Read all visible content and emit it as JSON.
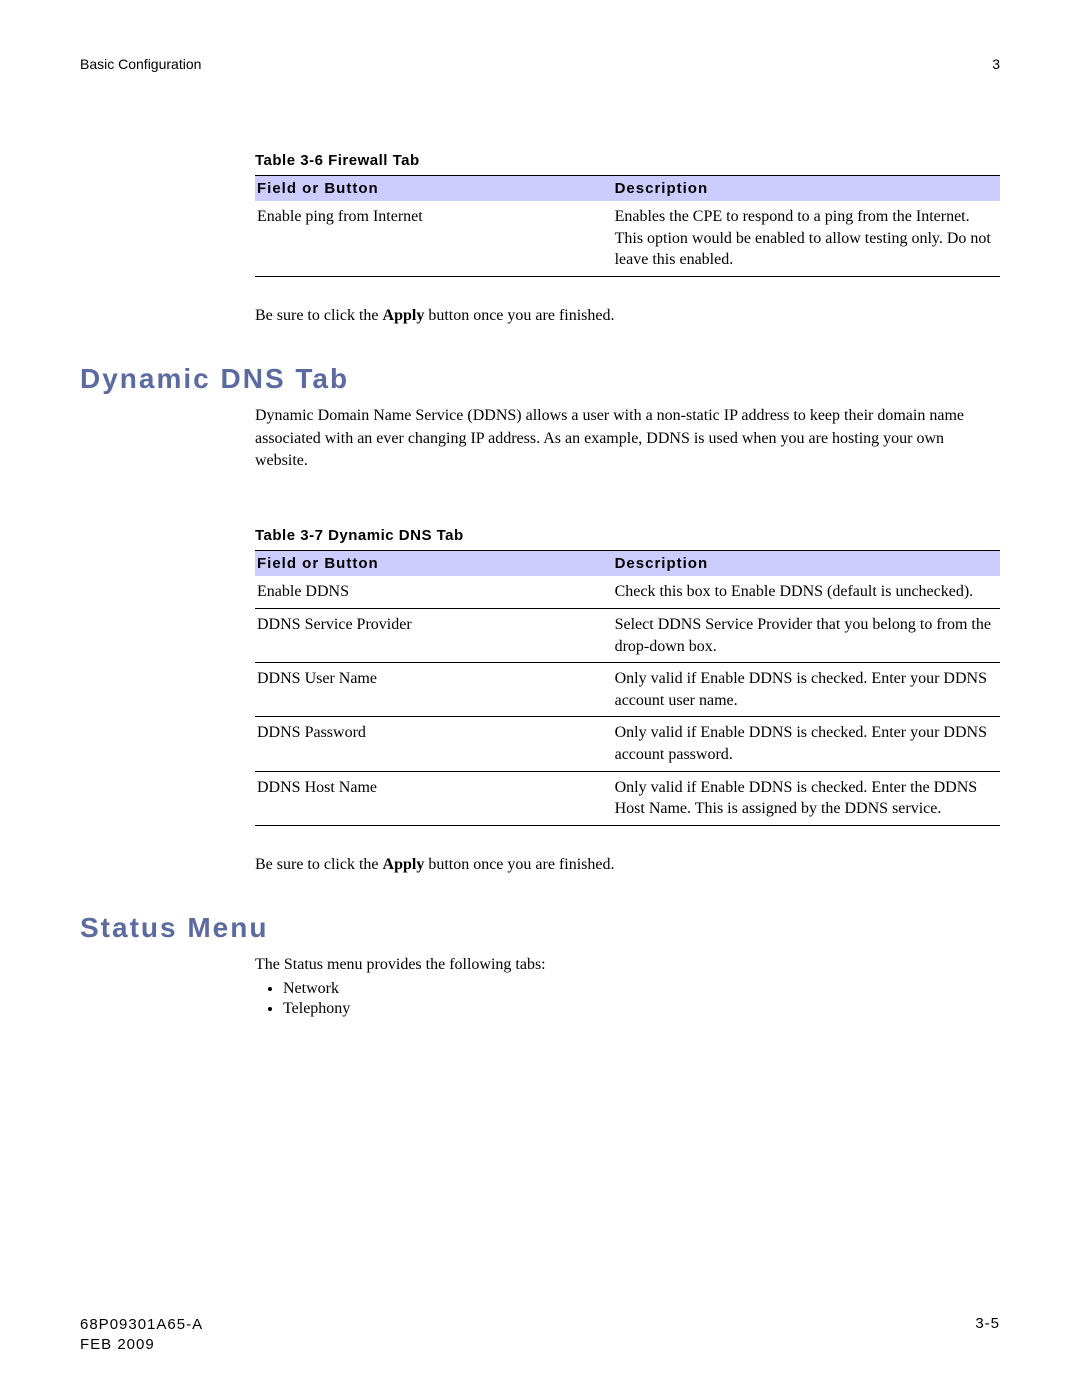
{
  "header": {
    "title": "Basic Configuration",
    "chapter": "3"
  },
  "table36": {
    "caption": "Table 3-6 Firewall Tab",
    "col1": "Field or Button",
    "col2": "Description",
    "rows": [
      {
        "field": "Enable ping from Internet",
        "desc": "Enables the CPE to respond to a ping from the Internet. This option would be enabled to allow testing only. Do not leave this enabled."
      }
    ]
  },
  "apply1": {
    "pre": "Be sure to click the ",
    "bold": "Apply",
    "post": " button once you are finished."
  },
  "ddns": {
    "heading": "Dynamic DNS Tab",
    "intro": "Dynamic Domain Name Service (DDNS) allows a user with a non-static IP address to keep their domain name associated with an ever changing IP address. As an example, DDNS is used when you are hosting your own website."
  },
  "table37": {
    "caption": "Table 3-7 Dynamic DNS Tab",
    "col1": "Field or Button",
    "col2": "Description",
    "rows": [
      {
        "field": "Enable DDNS",
        "desc": "Check this box to Enable DDNS (default is unchecked)."
      },
      {
        "field": "DDNS Service Provider",
        "desc": "Select DDNS Service Provider that you belong to from the drop-down box."
      },
      {
        "field": "DDNS User Name",
        "desc": "Only valid if Enable DDNS is checked. Enter your DDNS account user name."
      },
      {
        "field": "DDNS Password",
        "desc": "Only valid if Enable DDNS is checked. Enter your DDNS account password."
      },
      {
        "field": "DDNS Host Name",
        "desc": "Only valid if Enable DDNS is checked. Enter the DDNS Host Name. This is assigned by the DDNS service."
      }
    ]
  },
  "apply2": {
    "pre": "Be sure to click the ",
    "bold": "Apply",
    "post": " button once you are finished."
  },
  "status": {
    "heading": "Status Menu",
    "intro": "The Status menu provides the following tabs:",
    "items": [
      "Network",
      "Telephony"
    ]
  },
  "footer": {
    "docnum": "68P09301A65-A",
    "date": "FEB 2009",
    "pagenum": "3-5"
  }
}
